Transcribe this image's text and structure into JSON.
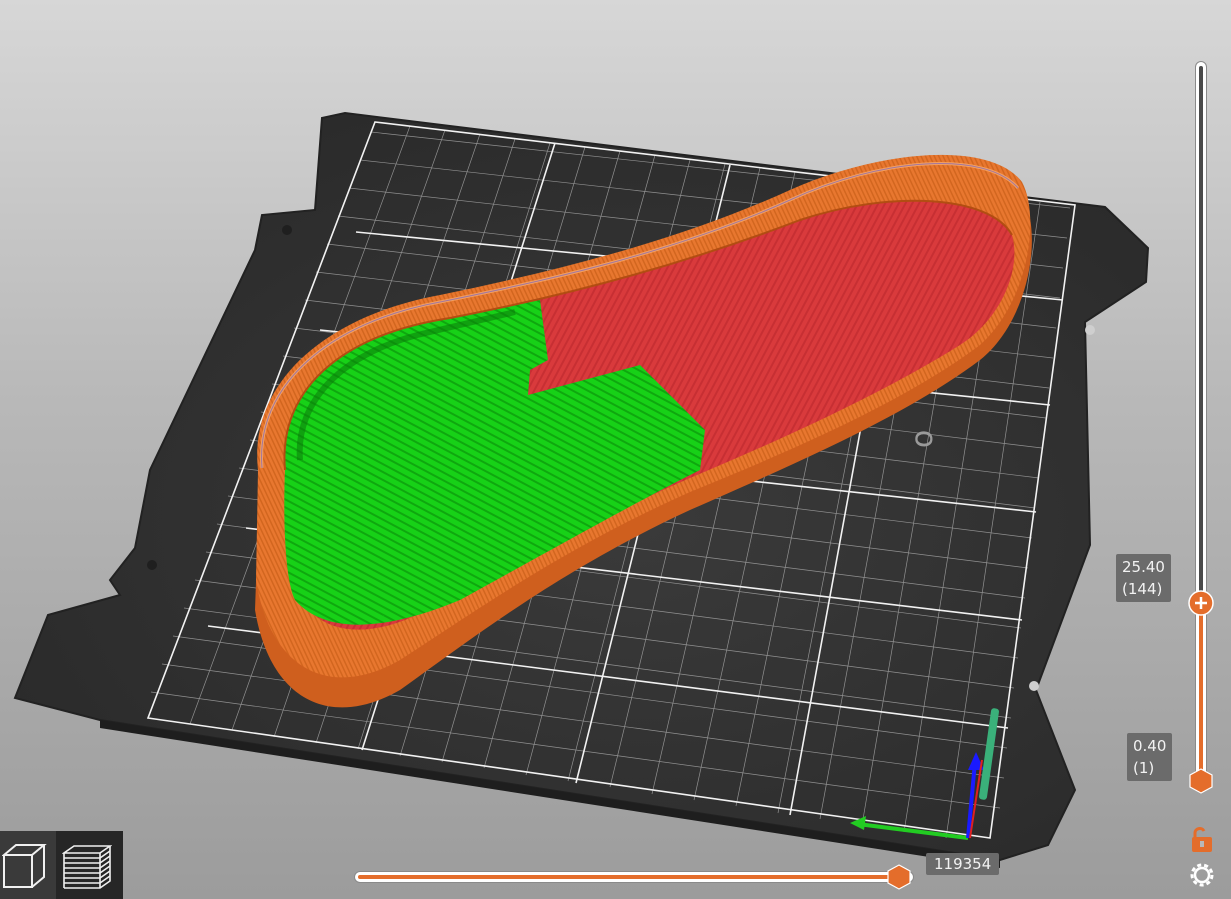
{
  "layer_slider": {
    "top": {
      "height": "25.40",
      "layer": "(144)"
    },
    "bottom": {
      "height": "0.40",
      "layer": "(1)"
    }
  },
  "move_slider": {
    "value": "119354"
  },
  "view_buttons": [
    {
      "name": "3d-view",
      "icon": "cube-icon"
    },
    {
      "name": "layer-view",
      "icon": "layers-icon"
    }
  ],
  "controls": {
    "lock_icon": "unlock-icon",
    "settings_icon": "gear-icon"
  },
  "colors": {
    "accent": "#e46d2b",
    "perimeter": "#e8772f",
    "infill": "#d9363a",
    "support": "#1fc21f",
    "bed": "#333333",
    "grid": "#ffffff"
  }
}
